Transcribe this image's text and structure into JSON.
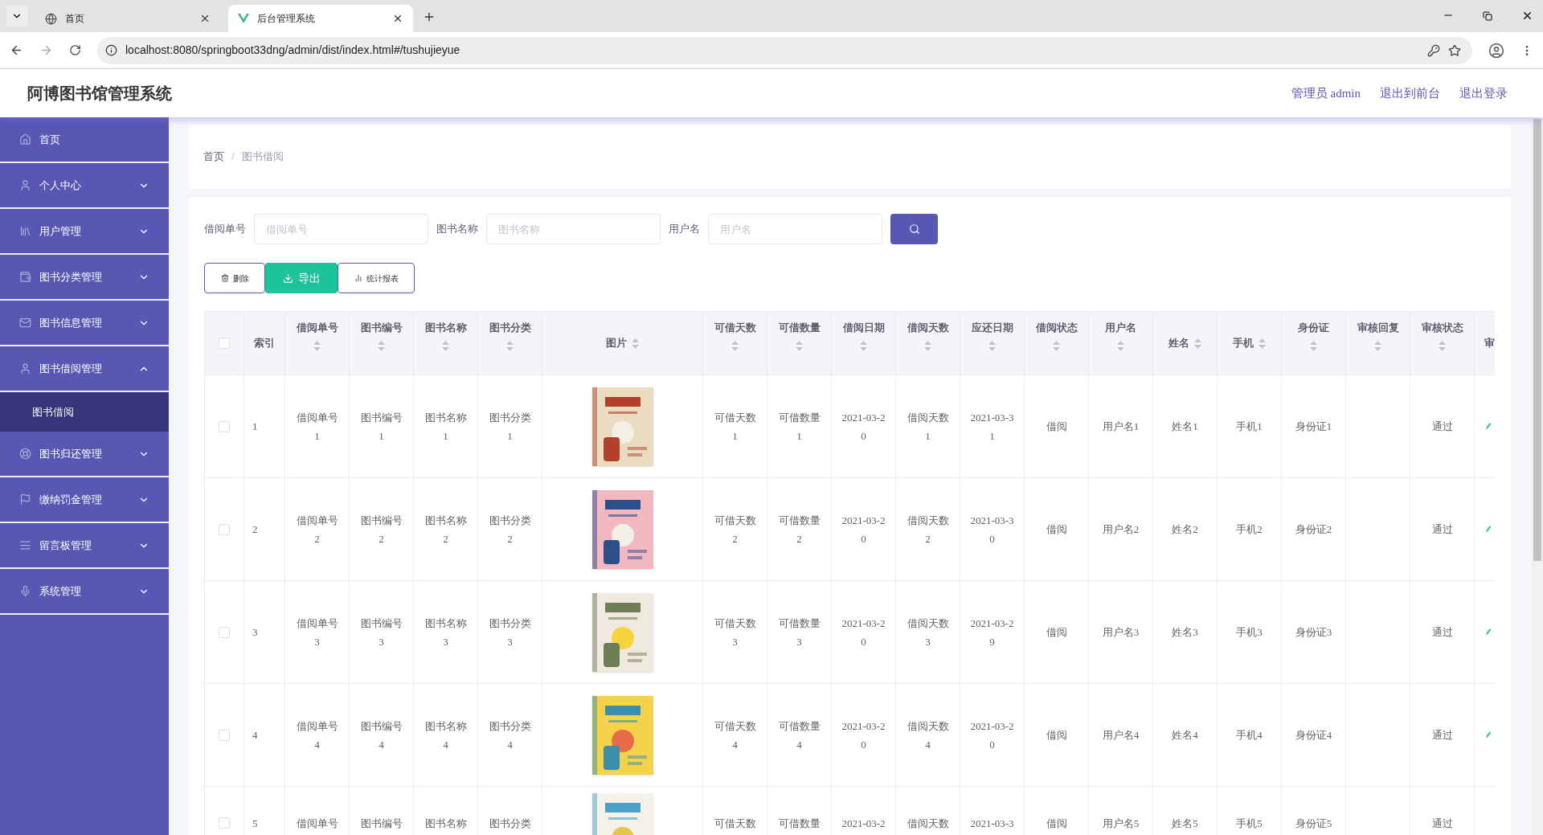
{
  "browser": {
    "tabs": [
      {
        "title": "首页",
        "selected": false
      },
      {
        "title": "后台管理系统",
        "selected": true
      }
    ],
    "url": "localhost:8080/springboot33dng/admin/dist/index.html#/tushujieyue"
  },
  "header": {
    "title": "阿博图书馆管理系统",
    "links": [
      "管理员 admin",
      "退出到前台",
      "退出登录"
    ]
  },
  "sidebar": {
    "items": [
      {
        "label": "首页",
        "kind": "link"
      },
      {
        "label": "个人中心",
        "kind": "group",
        "expanded": false
      },
      {
        "label": "用户管理",
        "kind": "group",
        "expanded": false
      },
      {
        "label": "图书分类管理",
        "kind": "group",
        "expanded": false
      },
      {
        "label": "图书信息管理",
        "kind": "group",
        "expanded": false
      },
      {
        "label": "图书借阅管理",
        "kind": "group",
        "expanded": true,
        "children": [
          {
            "label": "图书借阅",
            "selected": true
          }
        ]
      },
      {
        "label": "图书归还管理",
        "kind": "group",
        "expanded": false
      },
      {
        "label": "缴纳罚金管理",
        "kind": "group",
        "expanded": false
      },
      {
        "label": "留言板管理",
        "kind": "group",
        "expanded": false
      },
      {
        "label": "系统管理",
        "kind": "group",
        "expanded": false
      }
    ]
  },
  "breadcrumb": {
    "items": [
      "首页",
      "图书借阅"
    ],
    "separator": "/"
  },
  "search": {
    "fields": [
      {
        "label": "借阅单号",
        "placeholder": "借阅单号"
      },
      {
        "label": "图书名称",
        "placeholder": "图书名称"
      },
      {
        "label": "用户名",
        "placeholder": "用户名"
      }
    ]
  },
  "actions": [
    {
      "label": "删除",
      "kind": "delete"
    },
    {
      "label": "导出",
      "kind": "export"
    },
    {
      "label": "统计报表",
      "kind": "report"
    }
  ],
  "table": {
    "select_all_checked": false,
    "columns": [
      {
        "label": "索引",
        "kind": "text",
        "sortable": false
      },
      {
        "label": "借阅单号",
        "kind": "text",
        "sortable": true,
        "icon_beside": false
      },
      {
        "label": "图书编号",
        "kind": "text",
        "sortable": true,
        "icon_beside": false
      },
      {
        "label": "图书名称",
        "kind": "text",
        "sortable": true,
        "icon_beside": false
      },
      {
        "label": "图书分类",
        "kind": "text",
        "sortable": true,
        "icon_beside": false
      },
      {
        "label": "图片",
        "kind": "picture",
        "sortable": true,
        "icon_beside": true
      },
      {
        "label": "可借天数",
        "kind": "text",
        "sortable": true,
        "icon_beside": false
      },
      {
        "label": "可借数量",
        "kind": "text",
        "sortable": true,
        "icon_beside": false
      },
      {
        "label": "借阅日期",
        "kind": "text",
        "sortable": true,
        "icon_beside": false
      },
      {
        "label": "借阅天数",
        "kind": "text",
        "sortable": true,
        "icon_beside": false
      },
      {
        "label": "应还日期",
        "kind": "text",
        "sortable": true,
        "icon_beside": false
      },
      {
        "label": "借阅状态",
        "kind": "text",
        "sortable": true,
        "icon_beside": false
      },
      {
        "label": "用户名",
        "kind": "text",
        "sortable": true,
        "icon_beside": false
      },
      {
        "label": "姓名",
        "kind": "text",
        "sortable": true,
        "icon_beside": true
      },
      {
        "label": "手机",
        "kind": "text",
        "sortable": true,
        "icon_beside": true
      },
      {
        "label": "身份证",
        "kind": "text",
        "sortable": true,
        "icon_beside": false
      },
      {
        "label": "审核回复",
        "kind": "text",
        "sortable": true,
        "icon_beside": false
      },
      {
        "label": "审核状态",
        "kind": "text",
        "sortable": true,
        "icon_beside": false
      },
      {
        "label": "审",
        "kind": "action"
      }
    ],
    "rows": [
      {
        "checked": false,
        "cut": false,
        "index": "1",
        "loan_no": "借阅单号1",
        "book_no": "图书编号1",
        "book_name": "图书名称1",
        "book_category": "图书分类1",
        "loan_days_allowed": "可借天数1",
        "quantity_allowed": "可借数量1",
        "loan_date": "2021-03-20",
        "loan_days": "借阅天数1",
        "due_date": "2021-03-31",
        "loan_status": "借阅",
        "username": "用户名1",
        "name": "姓名1",
        "phone": "手机1",
        "id_card": "身份证1",
        "review_status": "通过"
      },
      {
        "checked": false,
        "cut": false,
        "index": "2",
        "loan_no": "借阅单号2",
        "book_no": "图书编号2",
        "book_name": "图书名称2",
        "book_category": "图书分类2",
        "loan_days_allowed": "可借天数2",
        "quantity_allowed": "可借数量2",
        "loan_date": "2021-03-20",
        "loan_days": "借阅天数2",
        "due_date": "2021-03-30",
        "loan_status": "借阅",
        "username": "用户名2",
        "name": "姓名2",
        "phone": "手机2",
        "id_card": "身份证2",
        "review_status": "通过"
      },
      {
        "checked": false,
        "cut": false,
        "index": "3",
        "loan_no": "借阅单号3",
        "book_no": "图书编号3",
        "book_name": "图书名称3",
        "book_category": "图书分类3",
        "loan_days_allowed": "可借天数3",
        "quantity_allowed": "可借数量3",
        "loan_date": "2021-03-20",
        "loan_days": "借阅天数3",
        "due_date": "2021-03-29",
        "loan_status": "借阅",
        "username": "用户名3",
        "name": "姓名3",
        "phone": "手机3",
        "id_card": "身份证3",
        "review_status": "通过"
      },
      {
        "checked": false,
        "cut": false,
        "index": "4",
        "loan_no": "借阅单号4",
        "book_no": "图书编号4",
        "book_name": "图书名称4",
        "book_category": "图书分类4",
        "loan_days_allowed": "可借天数4",
        "quantity_allowed": "可借数量4",
        "loan_date": "2021-03-20",
        "loan_days": "借阅天数4",
        "due_date": "2021-03-20",
        "loan_status": "借阅",
        "username": "用户名4",
        "name": "姓名4",
        "phone": "手机4",
        "id_card": "身份证4",
        "review_status": "通过"
      },
      {
        "checked": false,
        "cut": true,
        "index": "5",
        "loan_no": "借阅单号",
        "book_no": "图书编号",
        "book_name": "图书名称",
        "book_category": "图书分类",
        "loan_days_allowed": "可借天数",
        "quantity_allowed": "可借数量",
        "loan_date": "2021-03-2",
        "loan_days": "借阅天数",
        "due_date": "2021-03-3",
        "loan_status": "借阅",
        "username": "用户名5",
        "name": "姓名5",
        "phone": "手机5",
        "id_card": "身份证5",
        "review_status": "通过"
      }
    ]
  }
}
